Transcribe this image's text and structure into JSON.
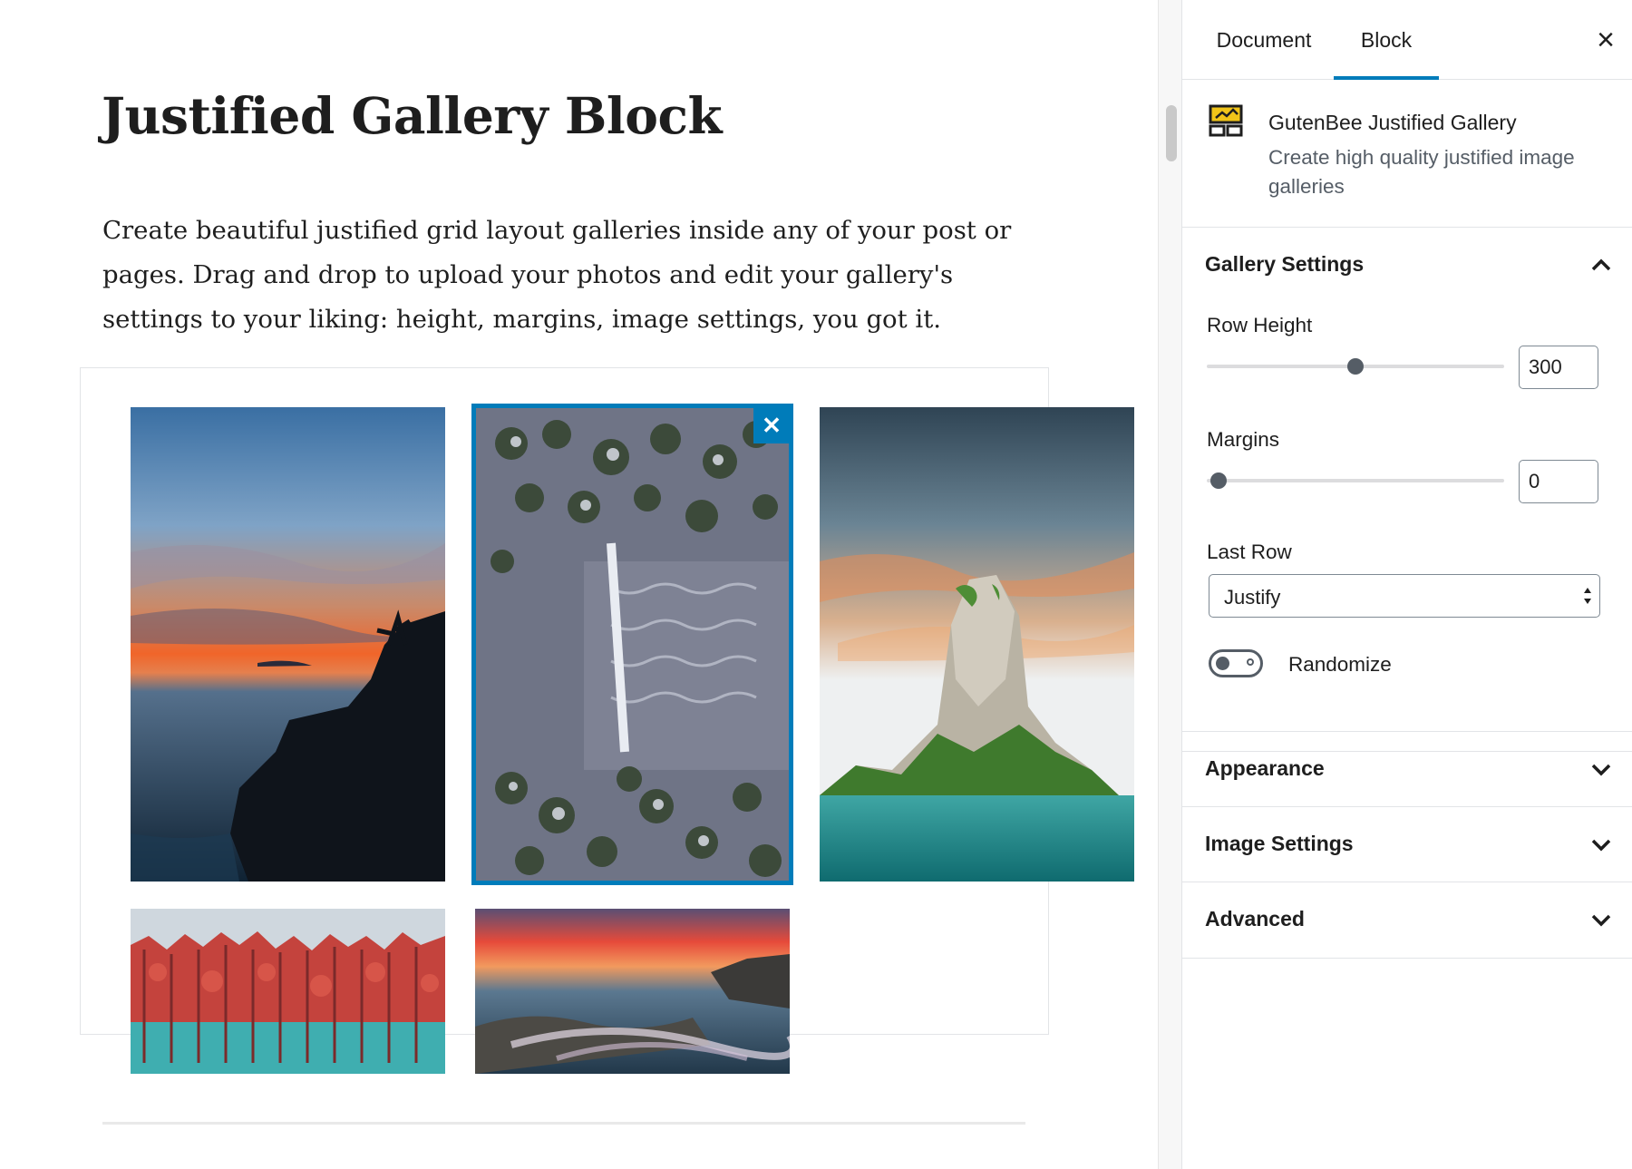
{
  "editor": {
    "title": "Justified Gallery Block",
    "paragraph": "Create beautiful justified grid layout galleries inside any of your post or pages. Drag and drop to upload your photos and edit your gallery's settings to your liking: height, margins, image settings, you got it.",
    "gallery": {
      "selected_index": 1,
      "remove_icon": "close-icon",
      "images": [
        {
          "scene": "sunset over sea cliff with palm tree"
        },
        {
          "scene": "aerial view of snowy forest with frozen river"
        },
        {
          "scene": "limestone rock island in turquoise sea"
        },
        {
          "scene": "red autumn trees reflected in turquoise lake"
        },
        {
          "scene": "long exposure sunset over rocky shoreline"
        }
      ]
    }
  },
  "sidebar": {
    "tabs": [
      {
        "label": "Document",
        "active": false
      },
      {
        "label": "Block",
        "active": true
      }
    ],
    "close_icon": "close-icon",
    "block_card": {
      "icon": "gallery-icon",
      "name": "GutenBee Justified Gallery",
      "description": "Create high quality justified image galleries"
    },
    "gallery_settings": {
      "title": "Gallery Settings",
      "expanded": true,
      "row_height": {
        "label": "Row Height",
        "value": "300",
        "slider_fraction": 0.5
      },
      "margins": {
        "label": "Margins",
        "value": "0",
        "slider_fraction": 0.04
      },
      "last_row": {
        "label": "Last Row",
        "selected": "Justify"
      },
      "randomize": {
        "label": "Randomize",
        "checked": false
      }
    },
    "panels": [
      {
        "title": "Appearance",
        "expanded": false
      },
      {
        "title": "Image Settings",
        "expanded": false
      },
      {
        "title": "Advanced",
        "expanded": false
      }
    ]
  },
  "colors": {
    "accent": "#007cba",
    "text": "#1e1e1e",
    "muted": "#555d66",
    "border": "#e2e4e7",
    "icon_yellow": "#f0c419"
  }
}
